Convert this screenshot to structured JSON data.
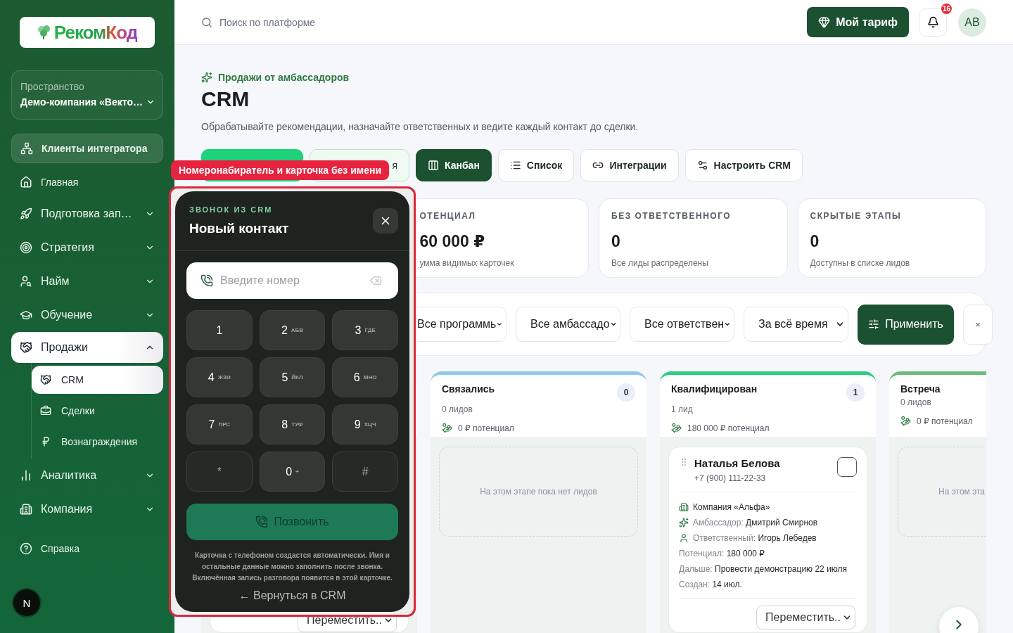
{
  "sidebar": {
    "logo": "РекомКод",
    "workspace": {
      "label": "Пространство",
      "value": "Демо-компания «Векто…"
    },
    "items": [
      {
        "label": "Клиенты интегратора",
        "kind": "highlight",
        "selected": false
      },
      {
        "label": "Главная",
        "kind": "link",
        "selected": false
      },
      {
        "label": "Подготовка зап…",
        "kind": "group",
        "expanded": false,
        "selected": false
      },
      {
        "label": "Стратегия",
        "kind": "group",
        "expanded": false,
        "selected": false
      },
      {
        "label": "Найм",
        "kind": "group",
        "expanded": false,
        "selected": false
      },
      {
        "label": "Обучение",
        "kind": "group",
        "expanded": false,
        "selected": false
      },
      {
        "label": "Продажи",
        "kind": "group",
        "expanded": true,
        "selected": true,
        "children": [
          {
            "label": "CRM",
            "selected": true
          },
          {
            "label": "Сделки",
            "selected": false
          },
          {
            "label": "Вознаграждения",
            "selected": false
          }
        ]
      },
      {
        "label": "Аналитика",
        "kind": "group",
        "expanded": false,
        "selected": false
      },
      {
        "label": "Компания",
        "kind": "group",
        "expanded": false,
        "selected": false
      },
      {
        "label": "Справка",
        "kind": "help",
        "selected": false
      }
    ],
    "dev_badge": "N"
  },
  "topbar": {
    "search": {
      "placeholder": "Поиск по платформе"
    },
    "plan_button": "Мой тариф",
    "notifications": "16",
    "avatar": "AB"
  },
  "header": {
    "eyebrow": "Продажи от амбассадоров",
    "title": "CRM",
    "description": "Обрабатывайте рекомендации, назначайте ответственных и ведите каждый контакт до сделки."
  },
  "tabs": [
    {
      "kind": "primary",
      "selected": false
    },
    {
      "label": "я",
      "kind": "soft",
      "selected": false
    },
    {
      "label": "Канбан",
      "kind": "plain",
      "selected": true
    },
    {
      "label": "Список",
      "kind": "plain",
      "selected": false
    },
    {
      "label": "Интеграции",
      "kind": "plain",
      "selected": false
    },
    {
      "label": "Настроить CRM",
      "kind": "plain",
      "selected": false
    }
  ],
  "stats": [
    {
      "label": "ОТЕНЦИАЛ",
      "value": "60 000 ₽",
      "hint": "умма видимых карточек"
    },
    {
      "label": "БЕЗ ОТВЕТСТВЕННОГО",
      "value": "0",
      "hint": "Все лиды распределены"
    },
    {
      "label": "СКРЫТЫЕ ЭТАПЫ",
      "value": "0",
      "hint": "Доступны в списке лидов"
    }
  ],
  "filters": {
    "selects": [
      "Все программь",
      "Все амбассадо",
      "Все ответствен",
      "За всё время"
    ],
    "apply": "Применить",
    "reset": "×"
  },
  "kanban": {
    "columns": [
      {
        "leads": [
          {
            "move": "Переместить.."
          }
        ]
      },
      {
        "title": "Связались",
        "count": "0",
        "subtitle": "0 лидов",
        "potential": "0 ₽ потенциал",
        "color": "#8ecae6",
        "empty": "На этом этапе пока нет лидов",
        "cut": false
      },
      {
        "title": "Квалифицирован",
        "count": "1",
        "subtitle": "1 лид",
        "potential": "180 000 ₽ потенциал",
        "color": "#2ecc80",
        "leads": [
          {
            "name": "Наталья Белова",
            "phone": "+7 (900) 111-22-33",
            "checked": false,
            "company": "Компания «Альфа»",
            "details": [
              {
                "kind": "ambassador",
                "label": "Амбассадор:",
                "value": "Дмитрий Смирнов"
              },
              {
                "kind": "owner",
                "label": "Ответственный:",
                "value": "Игорь Лебедев"
              },
              {
                "kind": "plain",
                "label": "Потенциал:",
                "value": "180 000 ₽"
              },
              {
                "kind": "plain",
                "label": "Дальше:",
                "value": "Провести демонстрацию 22 июля"
              },
              {
                "kind": "plain",
                "label": "Создан:",
                "value": "14 июл."
              }
            ],
            "move": "Переместить.."
          }
        ]
      },
      {
        "title": "Встреча",
        "subtitle": "0 лидов",
        "potential": "0 ₽ потенциал",
        "color": "#6dbb7e",
        "empty": "На этом эта",
        "cut": true
      }
    ]
  },
  "dialer": {
    "tag": "Номеронабиратель и карточка без имени",
    "eyebrow": "ЗВОНОК ИЗ CRM",
    "title": "Новый контакт",
    "input": {
      "placeholder": "Введите номер"
    },
    "keys": [
      {
        "digit": "1",
        "kind": "digit"
      },
      {
        "digit": "2",
        "letters": "АБВ",
        "kind": "digit"
      },
      {
        "digit": "3",
        "letters": "ГДЕ",
        "kind": "digit"
      },
      {
        "digit": "4",
        "letters": "ЖЗИ",
        "kind": "digit"
      },
      {
        "digit": "5",
        "letters": "ЙКЛ",
        "kind": "digit"
      },
      {
        "digit": "6",
        "letters": "МНО",
        "kind": "digit"
      },
      {
        "digit": "7",
        "letters": "ПРС",
        "kind": "digit"
      },
      {
        "digit": "8",
        "letters": "ТУФ",
        "kind": "digit"
      },
      {
        "digit": "9",
        "letters": "ХЦЧ",
        "kind": "digit"
      },
      {
        "digit": "*",
        "kind": "symbol"
      },
      {
        "digit": "0",
        "letters": "+",
        "kind": "digit"
      },
      {
        "digit": "#",
        "kind": "symbol"
      }
    ],
    "call_button": {
      "label": "Позвонить",
      "disabled": true
    },
    "note": "Карточка с телефоном создастся автоматически. Имя и остальные данные можно заполнить после звонка. Включённая запись разговора появится в этой карточке.",
    "back": "← Вернуться в CRM"
  }
}
